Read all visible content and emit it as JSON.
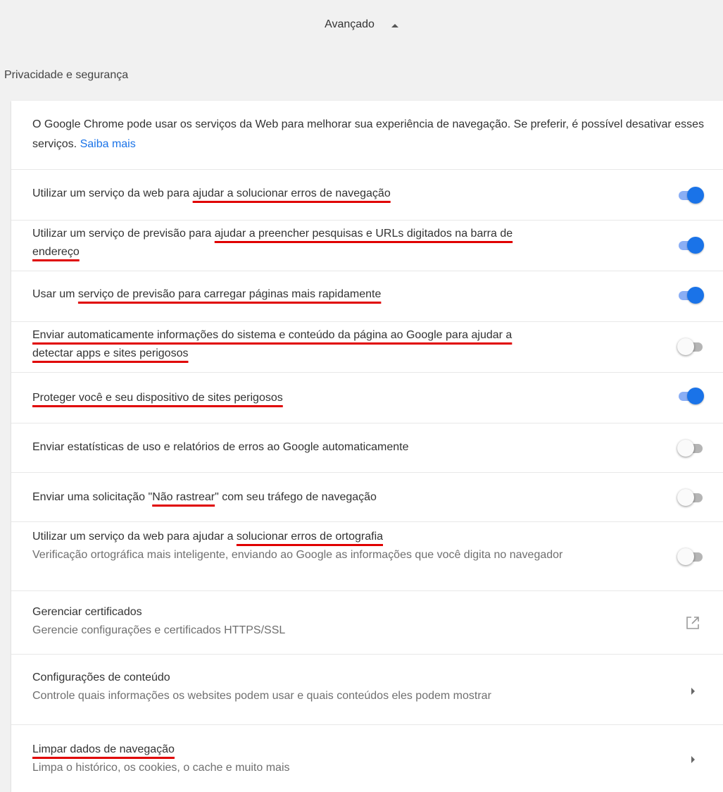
{
  "advanced": {
    "label": "Avançado",
    "icon": "caret-up-icon"
  },
  "section": {
    "title": "Privacidade e segurança"
  },
  "intro": {
    "text": "O Google Chrome pode usar os serviços da Web para melhorar sua experiência de navegação. Se preferir, é possível desativar esses serviços.",
    "link": "Saiba mais"
  },
  "settings": [
    {
      "pre": "Utilizar um serviço da web para ",
      "mark": "ajudar a solucionar erros de navegação",
      "post": "",
      "line2pre": "",
      "line2mark": "",
      "enabled": true
    },
    {
      "pre": "Utilizar um serviço de previsão para ",
      "mark": "ajudar a preencher pesquisas e URLs digitados na barra de",
      "post": "",
      "line2pre": "",
      "line2mark": "endereço",
      "enabled": true
    },
    {
      "pre": "Usar um ",
      "mark": "serviço de previsão para carregar páginas mais rapidamente",
      "post": "",
      "line2pre": "",
      "line2mark": "",
      "enabled": true
    },
    {
      "pre": "",
      "mark": "Enviar automaticamente informações do sistema e conteúdo da página ao Google para ajudar a",
      "post": "",
      "line2pre": "",
      "line2mark": "detectar apps e sites perigosos",
      "enabled": false
    },
    {
      "pre": "",
      "mark": "Proteger você e seu dispositivo de sites perigosos",
      "post": "",
      "line2pre": "",
      "line2mark": "",
      "enabled": true
    },
    {
      "pre": "Enviar estatísticas de uso e relatórios de erros ao Google automaticamente",
      "mark": "",
      "post": "",
      "line2pre": "",
      "line2mark": "",
      "enabled": false
    },
    {
      "pre": "Enviar uma solicitação \"",
      "mark": "Não rastrear",
      "post": "\" com seu tráfego de navegação",
      "line2pre": "",
      "line2mark": "",
      "enabled": false
    },
    {
      "pre": "Utilizar um serviço da web para ajudar a ",
      "mark": "solucionar erros de ortografia",
      "post": "",
      "line2pre": "",
      "line2mark": "",
      "secondary": "Verificação ortográfica mais inteligente, enviando ao Google as informações que você digita no navegador",
      "enabled": false
    }
  ],
  "certificates": {
    "title": "Gerenciar certificados",
    "secondary": "Gerencie configurações e certificados HTTPS/SSL",
    "icon": "open-in-new-icon"
  },
  "content_settings": {
    "title": "Configurações de conteúdo",
    "secondary": "Controle quais informações os websites podem usar e quais conteúdos eles podem mostrar",
    "icon": "arrow-right-icon"
  },
  "clear_data": {
    "title": "Limpar dados de navegação",
    "secondary": "Limpa o histórico, os cookies, o cache e muito mais",
    "icon": "arrow-right-icon"
  },
  "colors": {
    "accent": "#1a73e8",
    "underline": "#e00000"
  }
}
